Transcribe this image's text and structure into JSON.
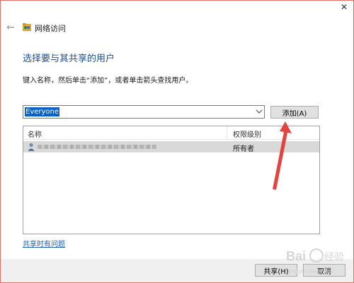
{
  "window": {
    "close_glyph": "✕",
    "title": "网络访问"
  },
  "main": {
    "heading": "选择要与其共享的用户",
    "instructions": "键入名称，然后单击“添加”，或者单击箭头查找用户。",
    "combo_value": "Everyone",
    "add_button": "添加(A)"
  },
  "list": {
    "columns": [
      "名称",
      "权限级别"
    ],
    "rows": [
      {
        "permission": "所有者"
      }
    ]
  },
  "help_link": "共享时有问题",
  "footer": {
    "share_button": "共享(H)",
    "cancel_button": "取消"
  },
  "watermark": {
    "text": "Bai 经验",
    "sub": "jingyan.baidu.com"
  },
  "colors": {
    "heading": "#1e4e9c",
    "selection": "#0a62c9",
    "annotation_arrow": "#e03a36"
  }
}
